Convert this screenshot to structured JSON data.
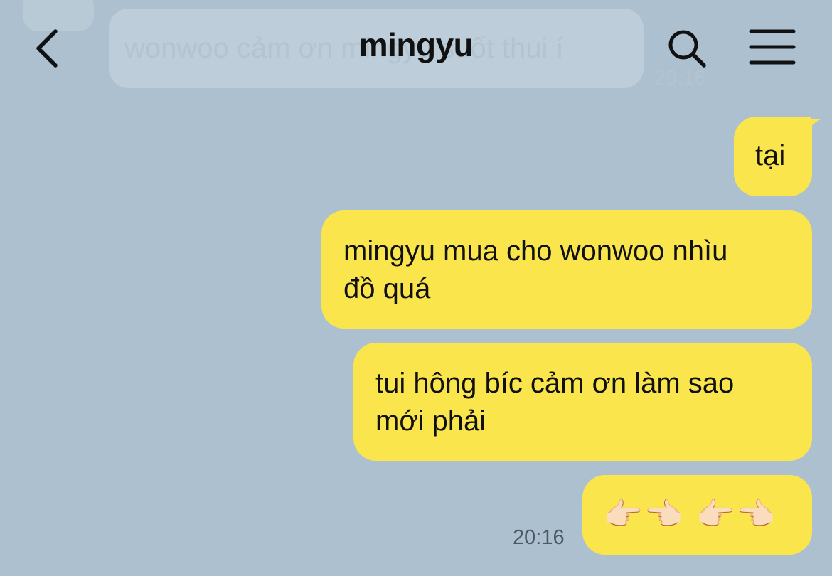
{
  "header": {
    "title": "mingyu"
  },
  "ghost_message": {
    "text": "wonwoo cảm ơn mingyu suốt thui í",
    "time": "20:16"
  },
  "messages": [
    {
      "text": "tại"
    },
    {
      "text": "mingyu mua cho wonwoo nhìu\nđồ quá"
    },
    {
      "text": "tui hông bíc cảm ơn làm sao\nmới phải"
    },
    {
      "text": "👉🏻👈🏻 👉🏻👈🏻"
    }
  ],
  "timestamp": "20:16",
  "colors": {
    "background": "#adc0d0",
    "bubble": "#fae64c",
    "text": "#111111",
    "timestamp": "#4d5a66"
  },
  "icons": {
    "back": "chevron-left-icon",
    "search": "search-icon",
    "menu": "hamburger-menu-icon"
  }
}
